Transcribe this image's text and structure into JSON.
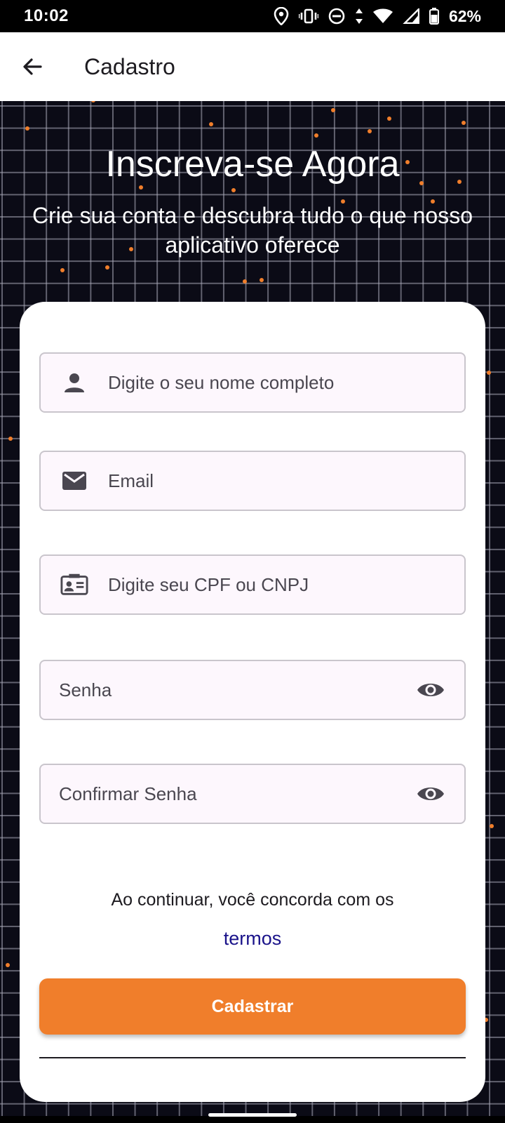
{
  "status_bar": {
    "time": "10:02",
    "battery": "62%",
    "icons": [
      "location-icon",
      "vibrate-icon",
      "do-not-disturb-icon",
      "data-arrows-icon",
      "wifi-icon",
      "signal-icon",
      "battery-icon"
    ]
  },
  "app_bar": {
    "title": "Cadastro",
    "back_icon": "arrow-back-icon"
  },
  "hero": {
    "headline": "Inscreva-se Agora",
    "subhead": "Crie sua conta e descubra tudo o que nosso aplicativo oferece"
  },
  "form": {
    "name_placeholder": "Digite o seu nome completo",
    "email_placeholder": "Email",
    "document_placeholder": "Digite seu CPF ou CNPJ",
    "password_placeholder": "Senha",
    "confirm_password_placeholder": "Confirmar Senha",
    "terms_text": "Ao continuar, você concorda com os",
    "terms_link": "termos",
    "submit_label": "Cadastrar"
  },
  "colors": {
    "accent": "#f07e2b",
    "background": "#0b0b16",
    "field_fill": "#fdf7fd",
    "link": "#1a138a"
  }
}
